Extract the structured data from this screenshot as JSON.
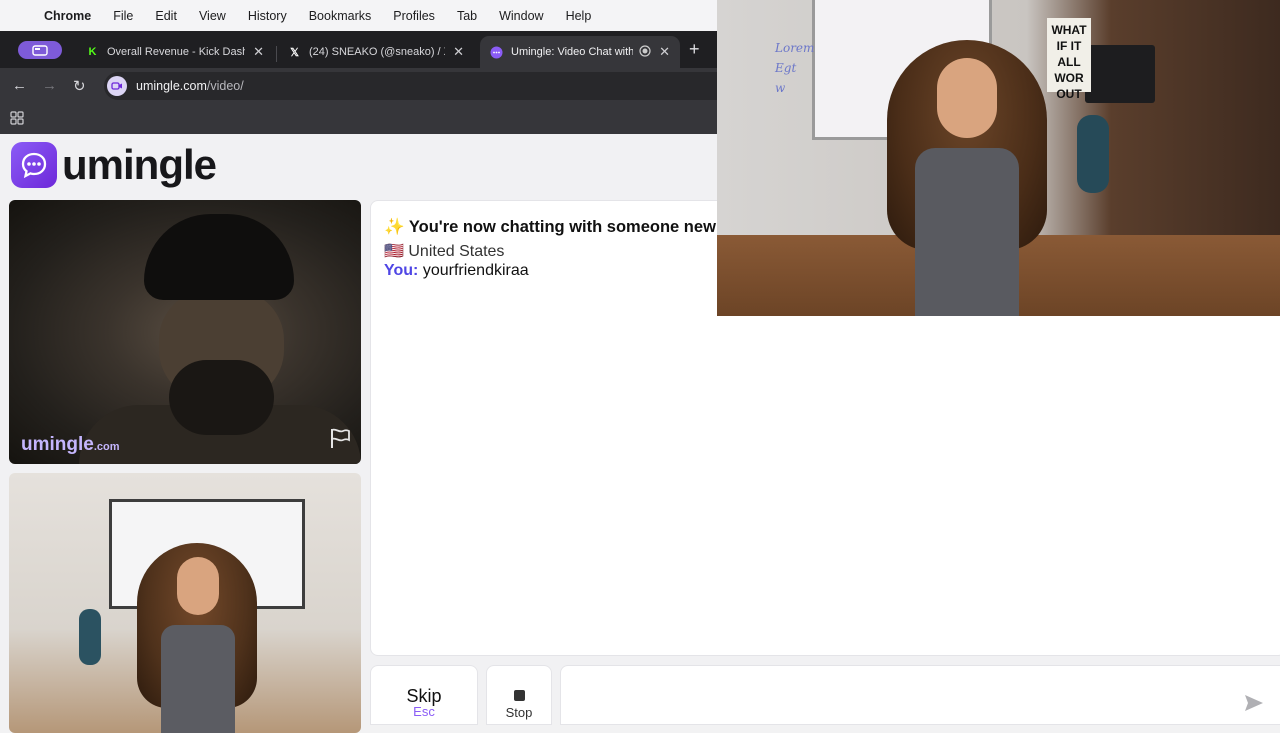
{
  "menubar": {
    "app_name": "Chrome",
    "items": [
      "File",
      "Edit",
      "View",
      "History",
      "Bookmarks",
      "Profiles",
      "Tab",
      "Window",
      "Help"
    ]
  },
  "tabs": [
    {
      "title": "Overall Revenue - Kick Dashb",
      "favicon": "kick-k-icon",
      "active": false
    },
    {
      "title": "(24) SNEAKO (@sneako) / X",
      "favicon": "x-logo-icon",
      "active": false
    },
    {
      "title": "Umingle: Video Chat with",
      "favicon": "umingle-chat-icon",
      "active": true
    }
  ],
  "omnibox": {
    "host": "umingle.com",
    "path": "/video/"
  },
  "site": {
    "logo_text": "umingle",
    "brand_color": "#7c3aed"
  },
  "stranger_video": {
    "watermark": "umingle",
    "watermark_suffix": ".com"
  },
  "chat": {
    "headline_emoji": "✨",
    "headline": "You're now chatting with someone new",
    "country_flag": "🇺🇸",
    "country": "United States",
    "you_label": "You:",
    "you_message": "yourfriendkiraa"
  },
  "controls": {
    "skip_label": "Skip",
    "skip_hint": "Esc",
    "stop_label": "Stop"
  },
  "webcam_scene": {
    "wall_art_text": "WHAT IF IT ALL WOR OUT",
    "board_scribble": "Lorem\nEgt\nw"
  }
}
